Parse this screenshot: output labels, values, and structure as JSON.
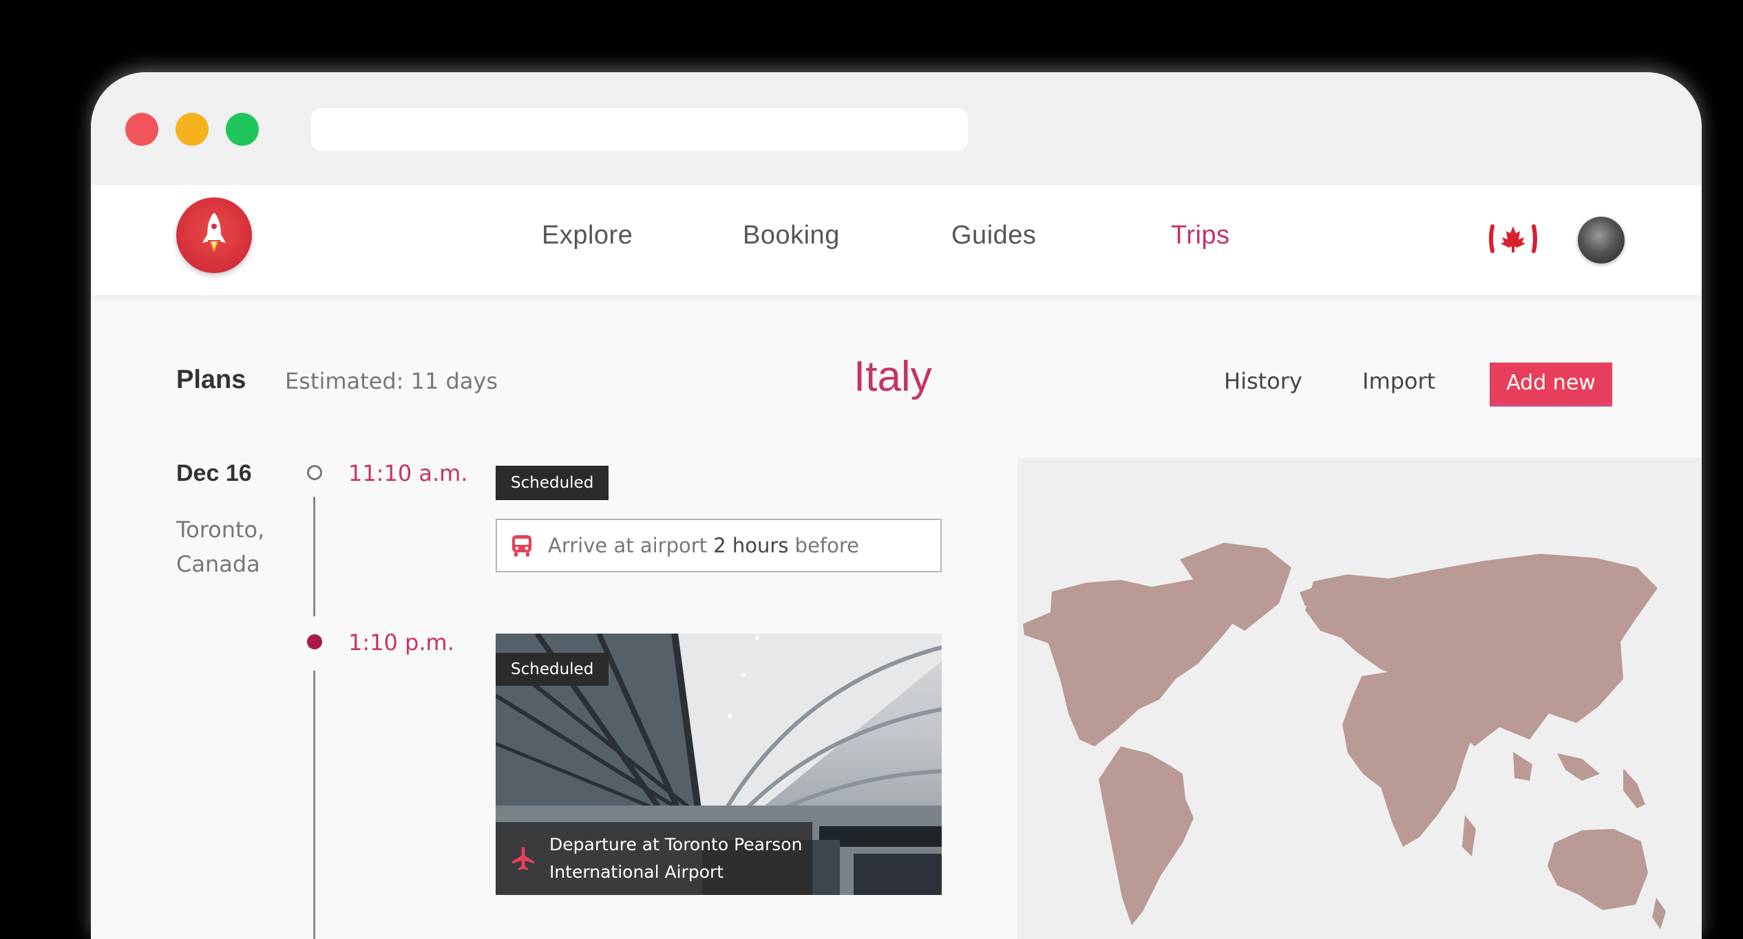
{
  "nav": {
    "items": [
      "Explore",
      "Booking",
      "Guides",
      "Trips"
    ],
    "active": "Trips"
  },
  "plans": {
    "title": "Plans",
    "estimate": "Estimated: 11 days",
    "country": "Italy",
    "history_label": "History",
    "import_label": "Import",
    "add_label": "Add new"
  },
  "itinerary": {
    "date": "Dec 16",
    "city": "Toronto, Canada",
    "events": [
      {
        "time": "11:10 a.m.",
        "status": "Scheduled",
        "notice_prefix": "Arrive at airport ",
        "notice_bold": "2 hours",
        "notice_suffix": " before"
      },
      {
        "time": "1:10 p.m.",
        "status": "Scheduled",
        "caption": "Departure at Toronto Pearson International Airport"
      }
    ]
  },
  "colors": {
    "accent": "#c73363",
    "button": "#e73f5b",
    "timeline_dot": "#a51a48",
    "map_land": "#b99a94"
  },
  "icons": [
    "rocket-icon",
    "canada-flag-icon",
    "bus-icon",
    "plane-icon"
  ]
}
